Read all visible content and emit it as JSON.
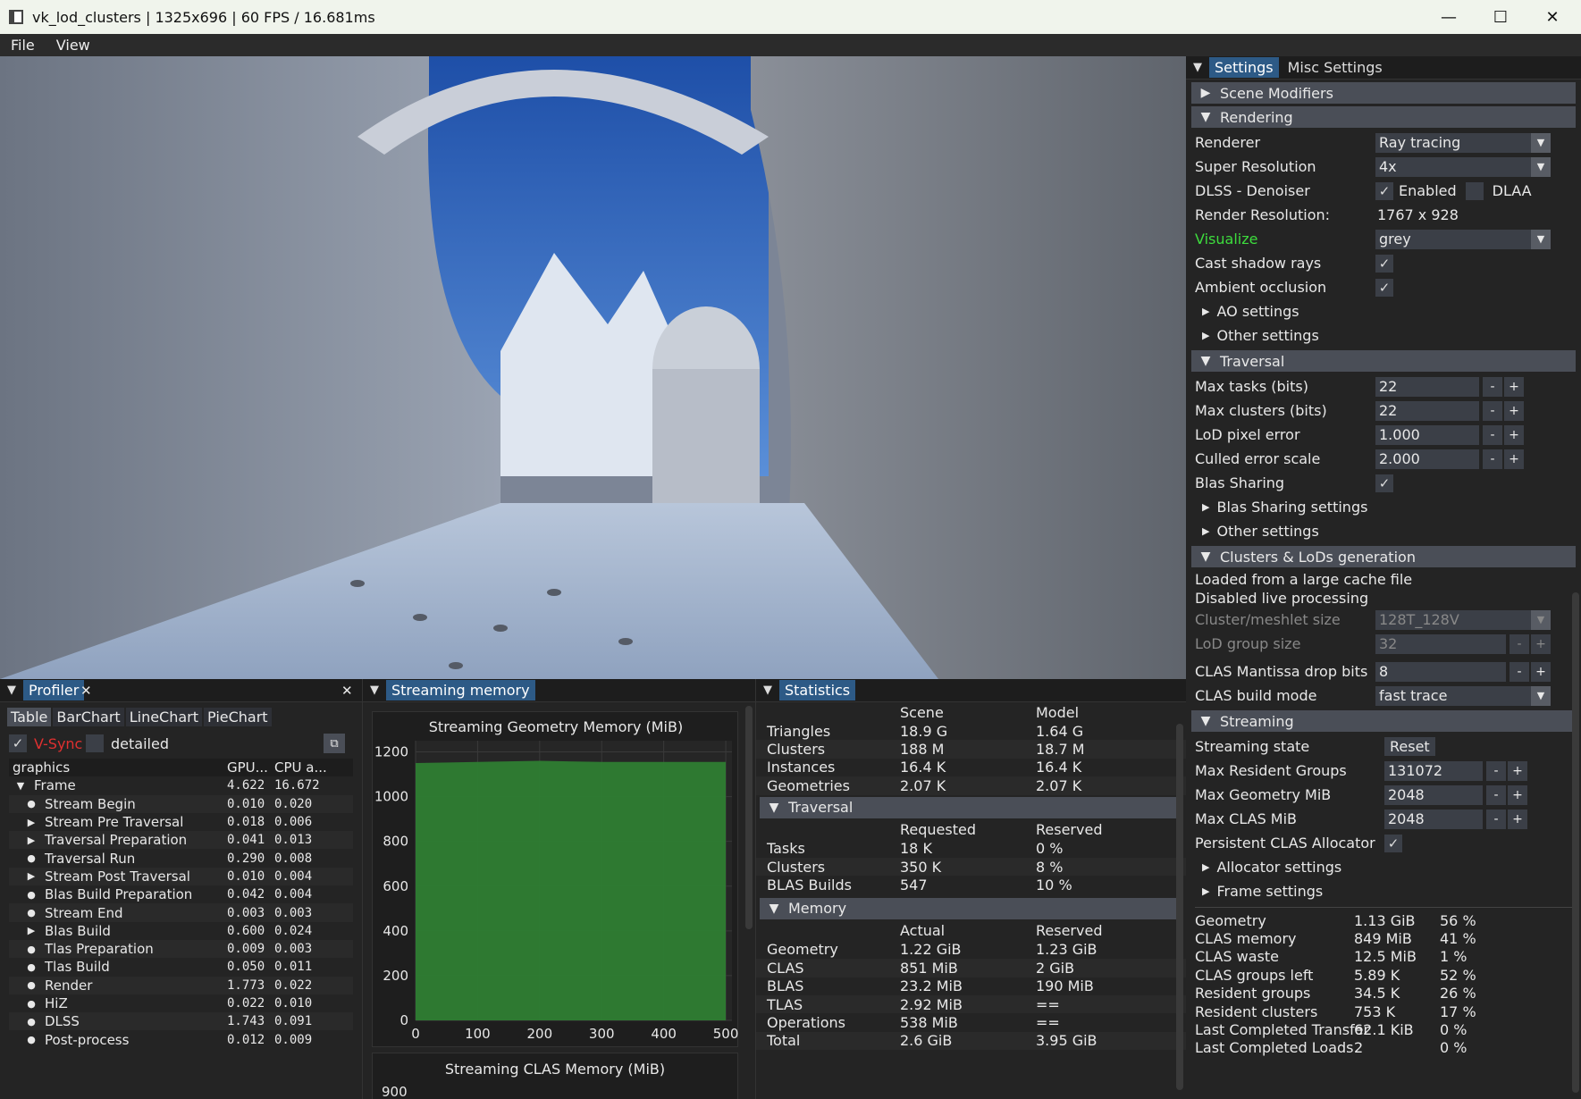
{
  "window": {
    "title": "vk_lod_clusters | 1325x696 | 60 FPS / 16.681ms",
    "minimize": "—",
    "maximize": "☐",
    "close": "✕"
  },
  "menu": {
    "items": [
      "File",
      "View"
    ]
  },
  "settings": {
    "tabs": [
      "Settings",
      "Misc Settings"
    ],
    "scene_modifiers": "Scene Modifiers",
    "rendering": {
      "header": "Rendering",
      "renderer_label": "Renderer",
      "renderer_value": "Ray tracing",
      "super_res_label": "Super Resolution",
      "super_res_value": "4x",
      "dlss_label": "DLSS - Denoiser",
      "dlss_enabled": "Enabled",
      "dlss_dlaa": "DLAA",
      "render_res_label": "Render Resolution:",
      "render_res_value": "1767 x 928",
      "visualize_label": "Visualize",
      "visualize_value": "grey",
      "shadow_label": "Cast shadow rays",
      "ao_label": "Ambient occlusion",
      "ao_settings": "AO settings",
      "other_settings": "Other settings"
    },
    "traversal": {
      "header": "Traversal",
      "rows": [
        {
          "label": "Max tasks (bits)",
          "value": "22"
        },
        {
          "label": "Max clusters (bits)",
          "value": "22"
        },
        {
          "label": "LoD pixel error",
          "value": "1.000"
        },
        {
          "label": "Culled error scale",
          "value": "2.000"
        }
      ],
      "blas_sharing": "Blas Sharing",
      "blas_sharing_settings": "Blas Sharing settings",
      "other_settings": "Other settings"
    },
    "clusters": {
      "header": "Clusters & LoDs generation",
      "line1": "Loaded from a large cache file",
      "line2": "Disabled live processing",
      "meshlet_label": "Cluster/meshlet size",
      "meshlet_value": "128T_128V",
      "lod_group_label": "LoD group size",
      "lod_group_value": "32",
      "mantissa_label": "CLAS Mantissa drop bits",
      "mantissa_value": "8",
      "build_mode_label": "CLAS build mode",
      "build_mode_value": "fast trace"
    },
    "streaming": {
      "header": "Streaming",
      "state_label": "Streaming state",
      "reset": "Reset",
      "rows": [
        {
          "label": "Max Resident Groups",
          "value": "131072"
        },
        {
          "label": "Max Geometry MiB",
          "value": "2048"
        },
        {
          "label": "Max CLAS MiB",
          "value": "2048"
        }
      ],
      "persistent_label": "Persistent CLAS Allocator",
      "allocator_settings": "Allocator settings",
      "frame_settings": "Frame settings",
      "stats": [
        {
          "label": "Geometry",
          "value": "1.13 GiB",
          "pct": "56 %"
        },
        {
          "label": "CLAS memory",
          "value": "849 MiB",
          "pct": "41 %"
        },
        {
          "label": "CLAS waste",
          "value": "12.5 MiB",
          "pct": "1 %"
        },
        {
          "label": "CLAS groups left",
          "value": "5.89 K",
          "pct": "52 %"
        },
        {
          "label": "Resident groups",
          "value": "34.5 K",
          "pct": "26 %"
        },
        {
          "label": "Resident clusters",
          "value": "753 K",
          "pct": "17 %"
        },
        {
          "label": "Last Completed Transfer",
          "value": "62.1 KiB",
          "pct": "0 %"
        },
        {
          "label": "Last Completed Loads",
          "value": "2",
          "pct": "0 %"
        }
      ]
    }
  },
  "profiler": {
    "title": "Profiler",
    "tabs": [
      "Table",
      "BarChart",
      "LineChart",
      "PieChart"
    ],
    "vsync": "V-Sync",
    "detailed": "detailed",
    "headers": [
      "graphics",
      "GPU...",
      "CPU a..."
    ],
    "rows": [
      {
        "name": "Frame",
        "gpu": "4.622",
        "cpu": "16.672",
        "kind": "open"
      },
      {
        "name": "Stream Begin",
        "gpu": "0.010",
        "cpu": "0.020",
        "kind": "bullet"
      },
      {
        "name": "Stream Pre Traversal",
        "gpu": "0.018",
        "cpu": "0.006",
        "kind": "closed"
      },
      {
        "name": "Traversal Preparation",
        "gpu": "0.041",
        "cpu": "0.013",
        "kind": "closed"
      },
      {
        "name": "Traversal Run",
        "gpu": "0.290",
        "cpu": "0.008",
        "kind": "bullet"
      },
      {
        "name": "Stream Post Traversal",
        "gpu": "0.010",
        "cpu": "0.004",
        "kind": "closed"
      },
      {
        "name": "Blas Build Preparation",
        "gpu": "0.042",
        "cpu": "0.004",
        "kind": "bullet"
      },
      {
        "name": "Stream End",
        "gpu": "0.003",
        "cpu": "0.003",
        "kind": "bullet"
      },
      {
        "name": "Blas Build",
        "gpu": "0.600",
        "cpu": "0.024",
        "kind": "closed"
      },
      {
        "name": "Tlas Preparation",
        "gpu": "0.009",
        "cpu": "0.003",
        "kind": "bullet"
      },
      {
        "name": "Tlas Build",
        "gpu": "0.050",
        "cpu": "0.011",
        "kind": "bullet"
      },
      {
        "name": "Render",
        "gpu": "1.773",
        "cpu": "0.022",
        "kind": "bullet"
      },
      {
        "name": "HiZ",
        "gpu": "0.022",
        "cpu": "0.010",
        "kind": "bullet"
      },
      {
        "name": "DLSS",
        "gpu": "1.743",
        "cpu": "0.091",
        "kind": "bullet"
      },
      {
        "name": "Post-process",
        "gpu": "0.012",
        "cpu": "0.009",
        "kind": "bullet"
      }
    ]
  },
  "streaming_memory": {
    "title": "Streaming memory",
    "chart2_title": "Streaming CLAS Memory (MiB)",
    "chart2_ytick": "900"
  },
  "chart_data": {
    "type": "area",
    "title": "Streaming Geometry Memory (MiB)",
    "x": [
      0,
      100,
      200,
      300,
      400,
      500
    ],
    "xlim": [
      0,
      510
    ],
    "ylim": [
      0,
      1250
    ],
    "yticks": [
      0,
      200,
      400,
      600,
      800,
      1000,
      1200
    ],
    "xticks": [
      0,
      100,
      200,
      300,
      400,
      500
    ],
    "series": [
      {
        "values": [
          1150,
          1155,
          1160,
          1155,
          1155,
          1155
        ]
      }
    ],
    "color": "#2e7d32"
  },
  "statistics": {
    "title": "Statistics",
    "headers": [
      "Scene",
      "Model"
    ],
    "rows": [
      {
        "label": "Triangles",
        "a": "18.9 G",
        "b": "1.64 G"
      },
      {
        "label": "Clusters",
        "a": "188 M",
        "b": "18.7 M"
      },
      {
        "label": "Instances",
        "a": "16.4 K",
        "b": "16.4 K"
      },
      {
        "label": "Geometries",
        "a": "2.07 K",
        "b": "2.07 K"
      }
    ],
    "traversal": {
      "header": "Traversal",
      "headers": [
        "Requested",
        "Reserved"
      ],
      "rows": [
        {
          "label": "Tasks",
          "a": "18 K",
          "b": "0 %"
        },
        {
          "label": "Clusters",
          "a": "350 K",
          "b": "8 %"
        },
        {
          "label": "BLAS Builds",
          "a": "547",
          "b": "10 %"
        }
      ]
    },
    "memory": {
      "header": "Memory",
      "headers": [
        "Actual",
        "Reserved"
      ],
      "rows": [
        {
          "label": "Geometry",
          "a": "1.22 GiB",
          "b": "1.23 GiB"
        },
        {
          "label": "CLAS",
          "a": "851 MiB",
          "b": "2 GiB"
        },
        {
          "label": "BLAS",
          "a": "23.2 MiB",
          "b": "190 MiB"
        },
        {
          "label": "TLAS",
          "a": "2.92 MiB",
          "b": "=="
        },
        {
          "label": "Operations",
          "a": "538 MiB",
          "b": "=="
        },
        {
          "label": "Total",
          "a": "2.6 GiB",
          "b": "3.95 GiB"
        }
      ]
    }
  },
  "colors": {
    "accent": "#2d5a86",
    "section": "#4a4e57",
    "visualize": "#3ddc3d",
    "vsync": "#e03030",
    "area": "#2e7d32"
  }
}
